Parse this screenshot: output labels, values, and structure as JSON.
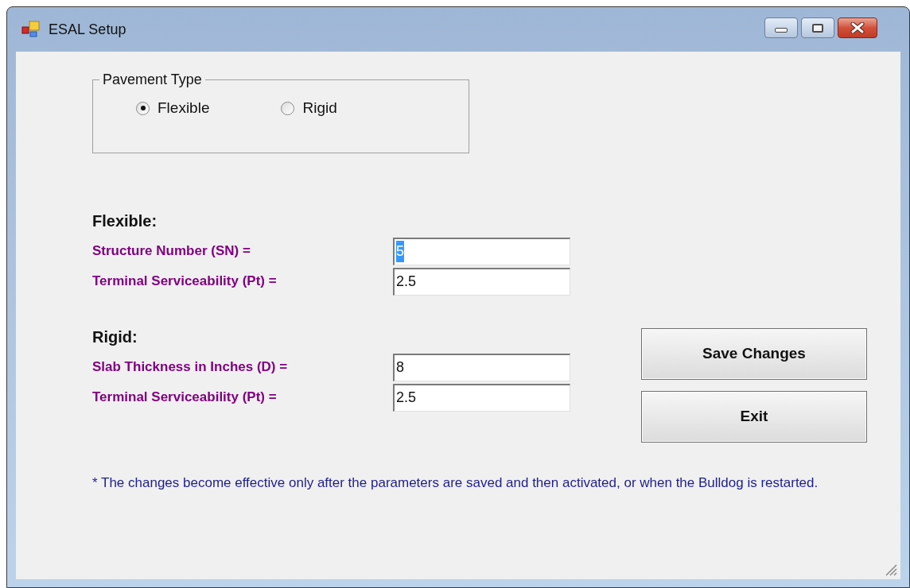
{
  "window": {
    "title": "ESAL Setup",
    "controls": [
      {
        "kind": "minimize"
      },
      {
        "kind": "maximize"
      },
      {
        "kind": "close"
      }
    ]
  },
  "pavement_type": {
    "label": "Pavement Type",
    "options": [
      {
        "label": "Flexible",
        "selected": true
      },
      {
        "label": "Rigid",
        "selected": false
      }
    ]
  },
  "sections": [
    {
      "heading": "Flexible:",
      "fields": [
        {
          "label": "Structure Number (SN) =",
          "value": "5",
          "text_selected": true
        },
        {
          "label": "Terminal Serviceability (Pt) =",
          "value": "2.5",
          "text_selected": false
        }
      ]
    },
    {
      "heading": "Rigid:",
      "fields": [
        {
          "label": "Slab Thickness in Inches (D) =",
          "value": "8",
          "text_selected": false
        },
        {
          "label": "Terminal Serviceability (Pt) =",
          "value": "2.5",
          "text_selected": false
        }
      ]
    }
  ],
  "buttons": [
    "Save Changes",
    "Exit"
  ],
  "note": "* The changes become effective only after the parameters are saved and then activated, or when the Bulldog is restarted."
}
